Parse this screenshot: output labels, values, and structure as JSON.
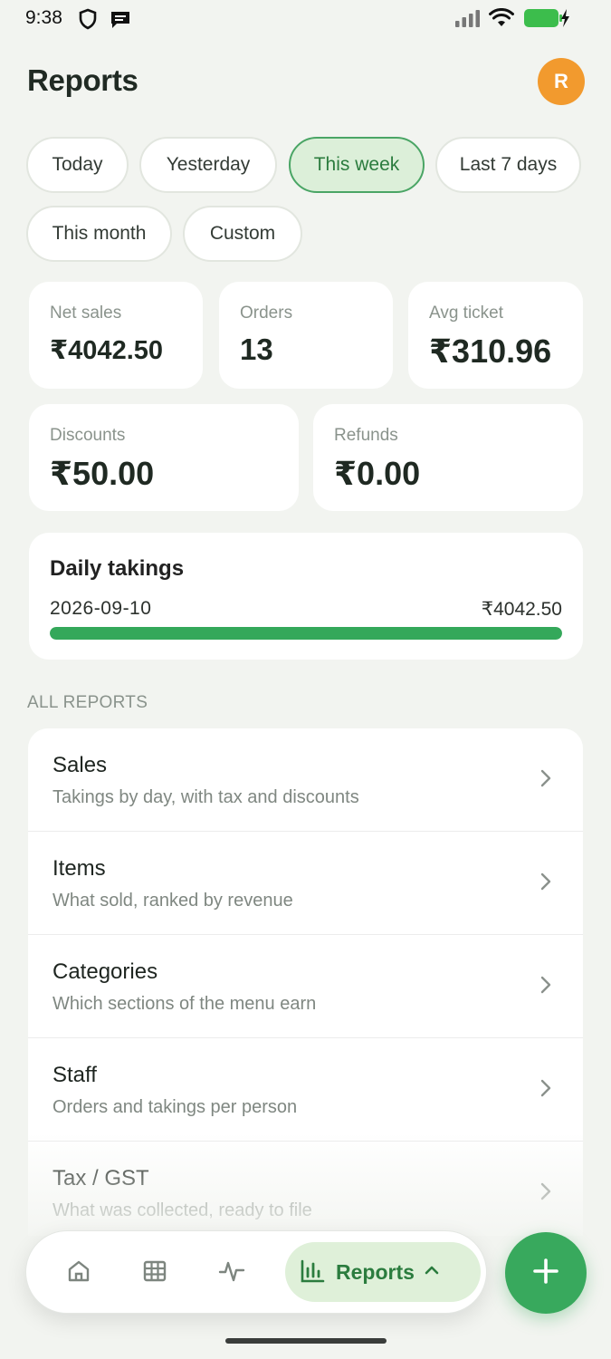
{
  "status_bar": {
    "time": "9:38"
  },
  "header": {
    "title": "Reports",
    "avatar_initial": "R"
  },
  "filters": {
    "chips": [
      "Today",
      "Yesterday",
      "This week",
      "Last 7 days",
      "This month",
      "Custom"
    ],
    "selected": "This week"
  },
  "stats": {
    "net_sales": {
      "label": "Net sales",
      "value": "₹4042.50"
    },
    "orders": {
      "label": "Orders",
      "value": "13"
    },
    "avg_ticket": {
      "label": "Avg ticket",
      "value": "₹310.96"
    },
    "discounts": {
      "label": "Discounts",
      "value": "₹50.00"
    },
    "refunds": {
      "label": "Refunds",
      "value": "₹0.00"
    }
  },
  "daily_takings": {
    "title": "Daily takings",
    "rows": [
      {
        "date": "2026-09-10",
        "amount": "₹4042.50",
        "fill_fraction": 1.0
      }
    ]
  },
  "reports_section": {
    "label": "ALL REPORTS",
    "items": [
      {
        "title": "Sales",
        "subtitle": "Takings by day, with tax and discounts"
      },
      {
        "title": "Items",
        "subtitle": "What sold, ranked by revenue"
      },
      {
        "title": "Categories",
        "subtitle": "Which sections of the menu earn"
      },
      {
        "title": "Staff",
        "subtitle": "Orders and takings per person"
      },
      {
        "title": "Tax / GST",
        "subtitle": "What was collected, ready to file"
      }
    ]
  },
  "bottom_nav": {
    "items": [
      {
        "icon": "home-icon"
      },
      {
        "icon": "grid-icon"
      },
      {
        "icon": "activity-icon"
      }
    ],
    "active_label": "Reports",
    "active_icon": "bar-chart-icon"
  },
  "colors": {
    "accent": "#38a95d",
    "avatar": "#f29a2e",
    "chip_active_bg": "#dcefd9",
    "background": "#f2f4f0"
  }
}
